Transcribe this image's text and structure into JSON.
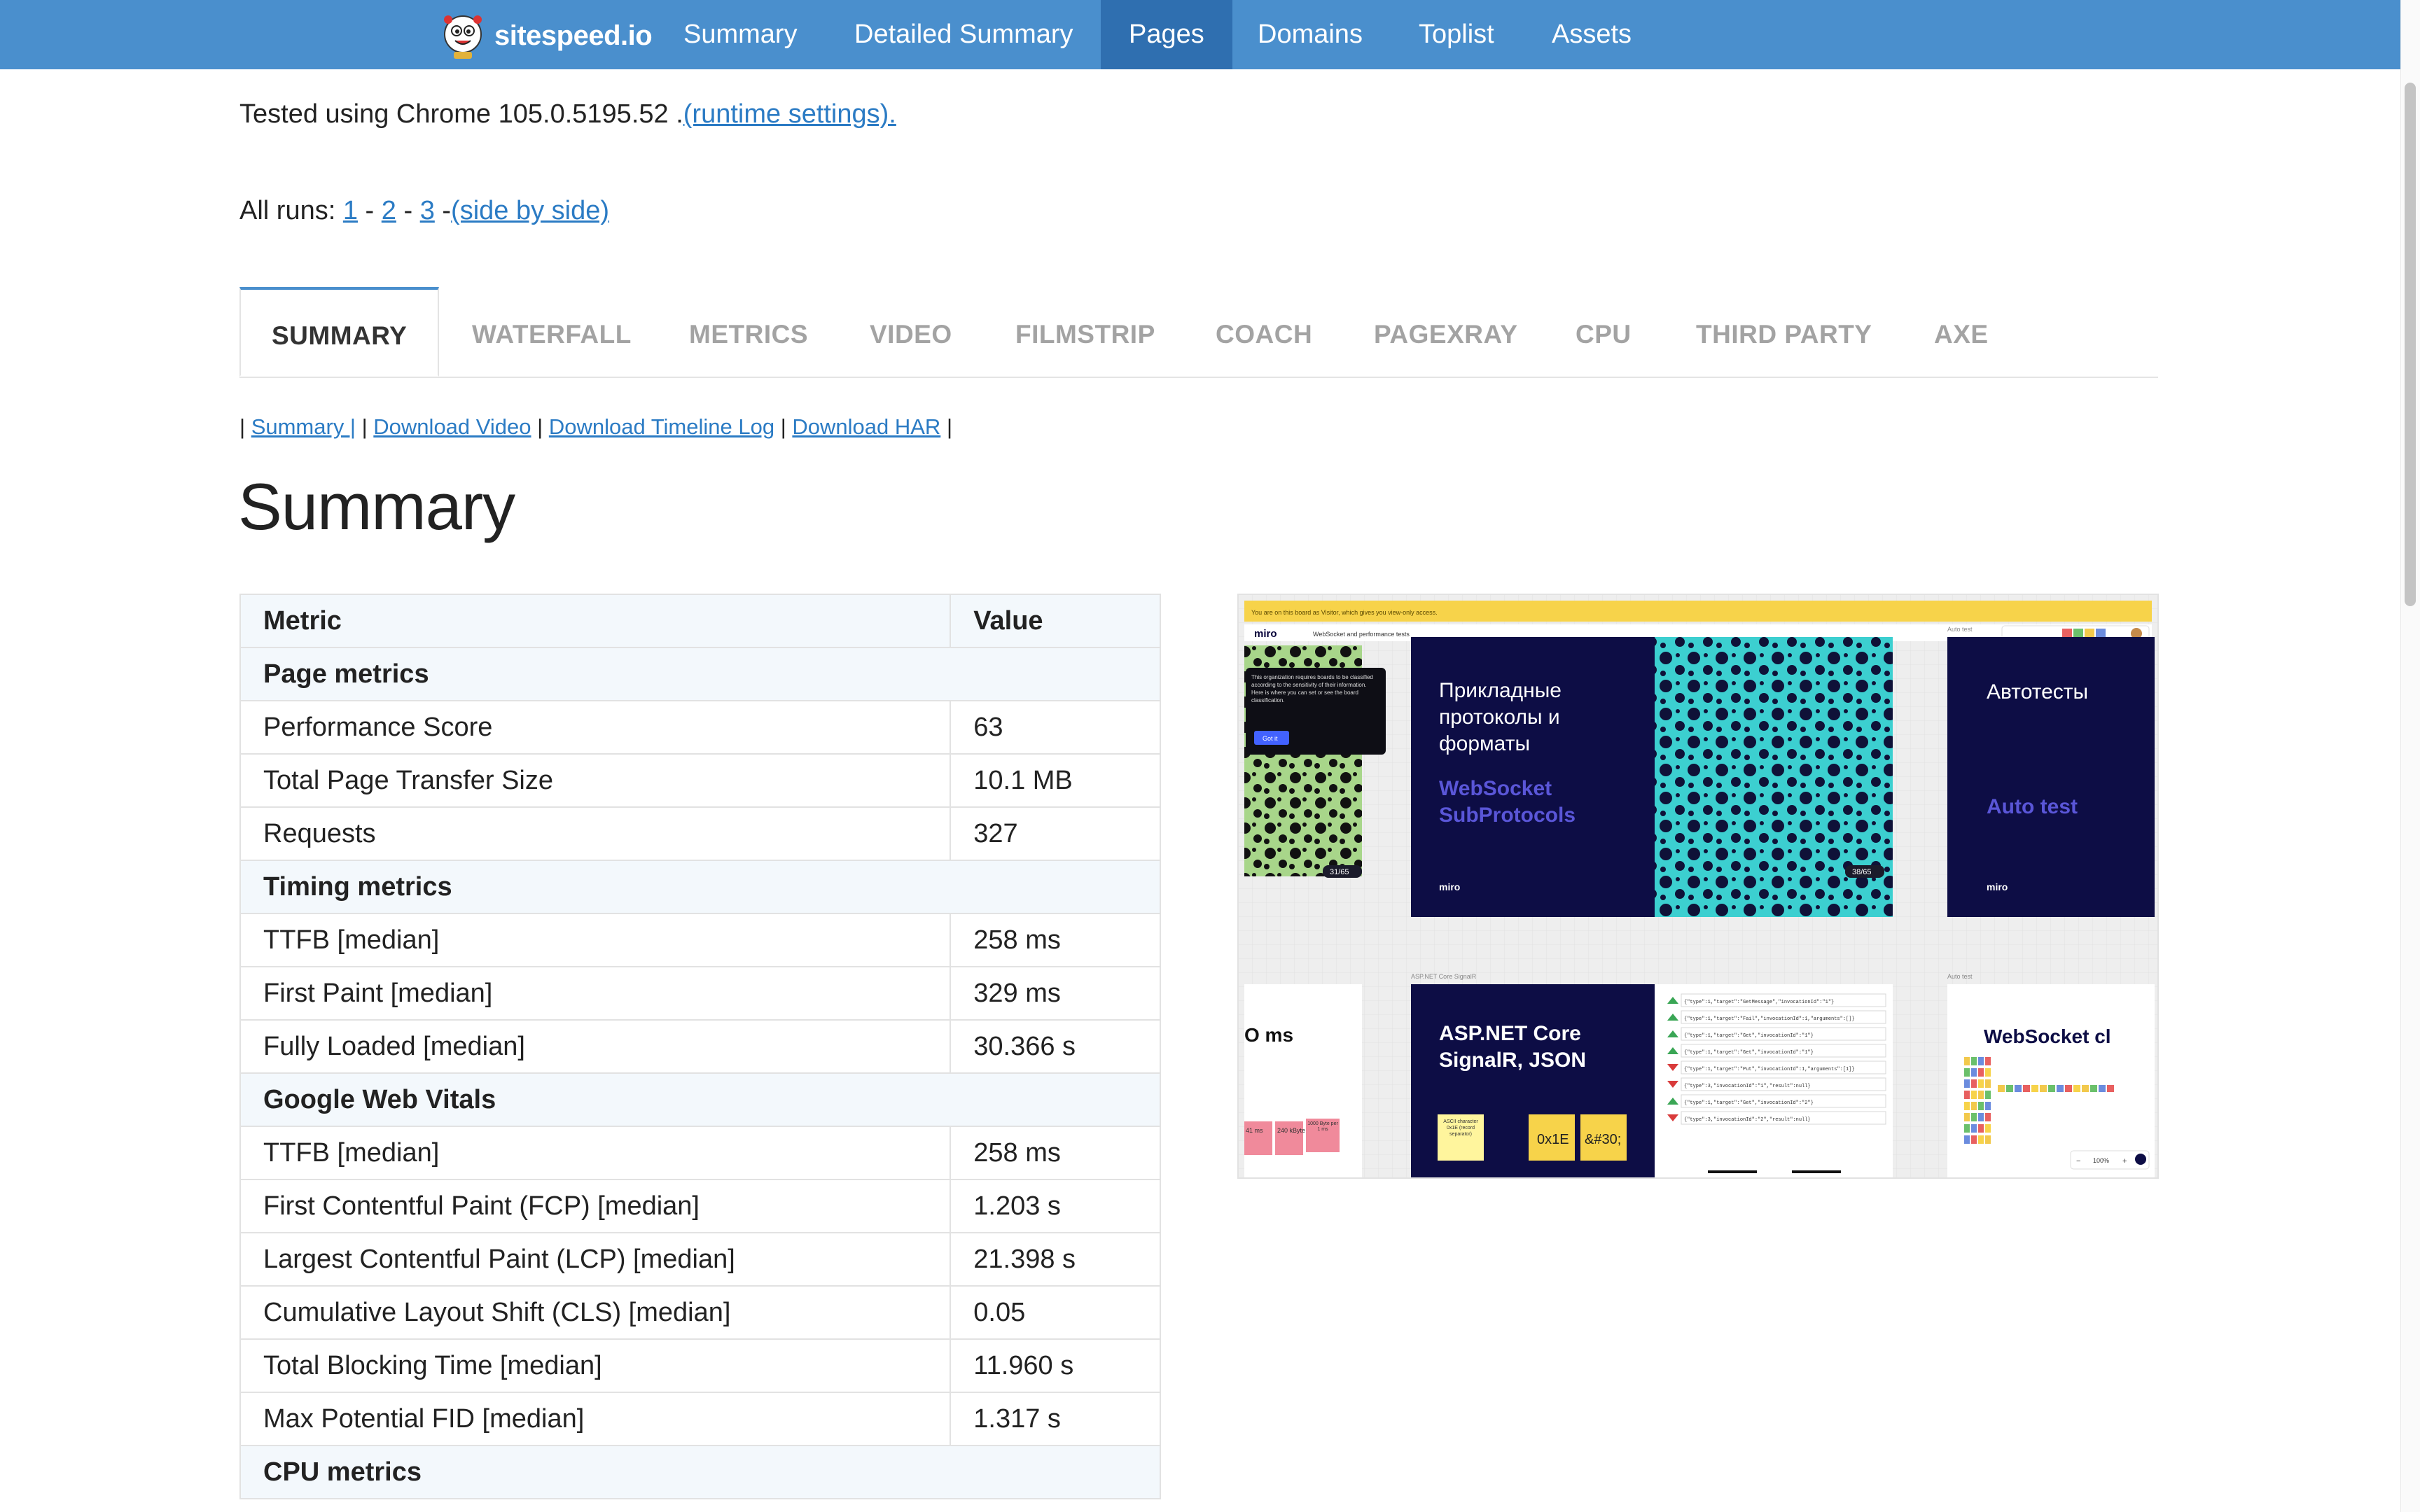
{
  "nav": {
    "brand": "sitespeed.io",
    "items": [
      "Summary",
      "Detailed Summary",
      "Pages",
      "Domains",
      "Toplist",
      "Assets"
    ],
    "active": "Pages"
  },
  "tested": {
    "text": "Tested using Chrome 105.0.5195.52 .",
    "link": "(runtime settings)."
  },
  "runs": {
    "label": "All runs:",
    "run1": "1",
    "run2": "2",
    "run3": "3",
    "sep": "-",
    "side": "(side by side)"
  },
  "tabs": [
    "SUMMARY",
    "WATERFALL",
    "METRICS",
    "VIDEO",
    "FILMSTRIP",
    "COACH",
    "PAGEXRAY",
    "CPU",
    "THIRD PARTY",
    "AXE"
  ],
  "sublinks": {
    "summary": "Summary |",
    "video": "Download Video",
    "timeline": "Download Timeline Log",
    "har": "Download HAR"
  },
  "heading": "Summary",
  "table": {
    "col_metric": "Metric",
    "col_value": "Value",
    "rows": [
      {
        "section": "Page metrics"
      },
      {
        "metric": "Performance Score",
        "value": "63"
      },
      {
        "metric": "Total Page Transfer Size",
        "value": "10.1 MB"
      },
      {
        "metric": "Requests",
        "value": "327"
      },
      {
        "section": "Timing metrics"
      },
      {
        "metric": "TTFB [median]",
        "value": "258 ms"
      },
      {
        "metric": "First Paint [median]",
        "value": "329 ms"
      },
      {
        "metric": "Fully Loaded [median]",
        "value": "30.366 s"
      },
      {
        "section": "Google Web Vitals"
      },
      {
        "metric": "TTFB [median]",
        "value": "258 ms"
      },
      {
        "metric": "First Contentful Paint (FCP) [median]",
        "value": "1.203 s"
      },
      {
        "metric": "Largest Contentful Paint (LCP) [median]",
        "value": "21.398 s"
      },
      {
        "metric": "Cumulative Layout Shift (CLS) [median]",
        "value": "0.05"
      },
      {
        "metric": "Total Blocking Time [median]",
        "value": "11.960 s"
      },
      {
        "metric": "Max Potential FID [median]",
        "value": "1.317 s"
      },
      {
        "section": "CPU metrics"
      }
    ]
  },
  "screenshot": {
    "banner": "You are on this board as Visitor, which gives you view-only access.",
    "brand": "miro",
    "board_title": "WebSocket and performance tests",
    "slide1_title": "Прикладные протоколы и форматы",
    "slide1_sub": "WebSocket SubProtocols",
    "slide2_title": "Автотесты",
    "slide2_sub": "Auto test",
    "slide3_title": "ASP.NET Core SignalR, JSON",
    "slide4_title": "WebSocket cl",
    "ms_label": "O ms",
    "counter1": "31/65",
    "counter2": "38/65",
    "frame_label1": "ASP.NET Core SignalR",
    "frame_label2": "Auto test",
    "frame_label3": "Auto test",
    "popup_text": "This organization requires boards to be classified according to the sensitivity of their information. Here is where you can set or see the board classification.",
    "popup_btn": "Got it",
    "hex1": "0x1E",
    "hex2": "&#30;",
    "ascii_note": "ASCII character 0x1E (record separator)",
    "stickies": [
      "41 ms",
      "240 kByte",
      "1000 Byte per 1 ms"
    ],
    "zoom": "100%",
    "json_lines": [
      "{\"type\":1,\"target\":\"GetMessage\",\"invocationId\":\"1\"}",
      "{\"type\":1,\"target\":\"Fail\",\"invocationId\":1,\"arguments\":[]}",
      "{\"type\":1,\"target\":\"Get\",\"invocationId\":\"1\"}",
      "{\"type\":1,\"target\":\"Get\",\"invocationId\":\"1\"}",
      "{\"type\":1,\"target\":\"Put\",\"invocationId\":1,\"arguments\":[1]}",
      "{\"type\":3,\"invocationId\":\"1\",\"result\":null}",
      "{\"type\":1,\"target\":\"Get\",\"invocationId\":\"2\"}",
      "{\"type\":3,\"invocationId\":\"2\",\"result\":null}"
    ]
  },
  "colors": {
    "nav_bg": "#4a8fcd",
    "nav_active": "#2f6fb0",
    "link": "#2b7bc4",
    "miro_navy": "#0d0d45",
    "miro_yellow": "#f7d34a"
  }
}
